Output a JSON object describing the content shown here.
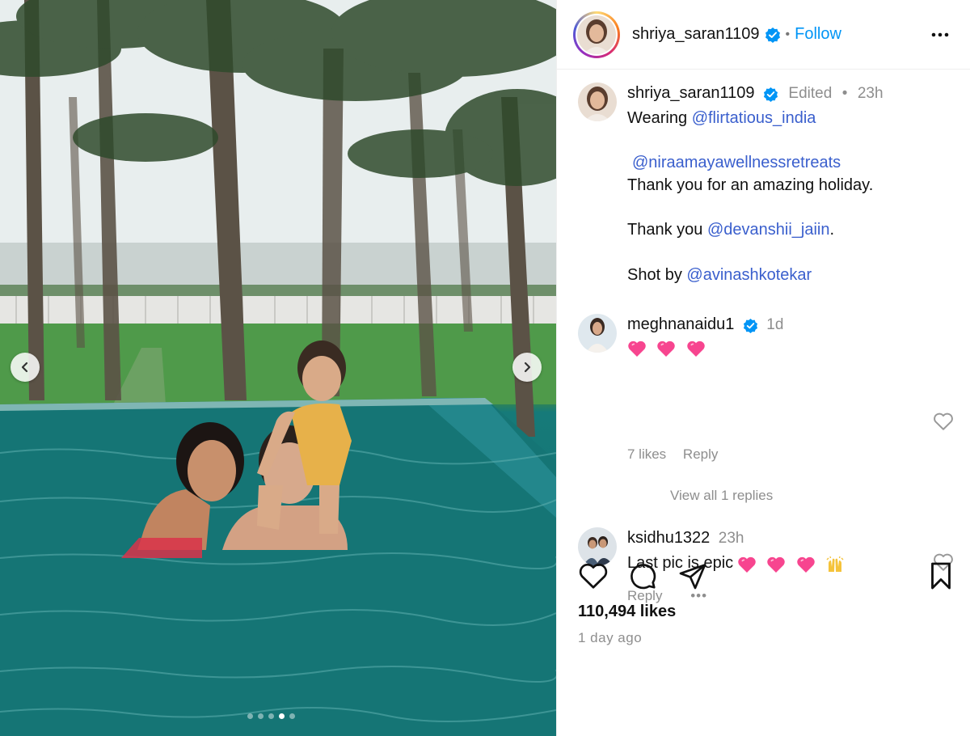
{
  "post": {
    "username": "shriya_saran1109",
    "follow_label": "Follow",
    "edited_label": "Edited",
    "time": "23h",
    "caption": {
      "line1_prefix": "Wearing",
      "mention1": "@flirtatious_india",
      "mention2": "@niraamayawellnessretreats",
      "line3": "Thank you for an amazing holiday.",
      "line4_prefix": "Thank you",
      "mention3": "@devanshii_jaiin",
      "line4_suffix": ".",
      "line5_prefix": "Shot by",
      "mention4": "@avinashkotekar"
    },
    "likes": "110,494 likes",
    "posted_ago": "1 day ago",
    "carousel": {
      "total_slides": 5,
      "active_slide": 4
    }
  },
  "comments": [
    {
      "username": "meghnanaidu1",
      "verified": true,
      "time": "1d",
      "emoji": [
        "pink-heart",
        "pink-heart",
        "pink-heart"
      ],
      "likes": "7 likes",
      "reply_label": "Reply",
      "view_replies": "View all 1 replies"
    },
    {
      "username": "ksidhu1322",
      "verified": false,
      "time": "23h",
      "text": "Last pic is epic",
      "emoji": [
        "pink-heart",
        "pink-heart",
        "pink-heart",
        "raised-hands"
      ],
      "reply_label": "Reply",
      "more": "•••"
    }
  ],
  "colors": {
    "link": "#0095f6",
    "mention": "#3a5fcd",
    "verified": "#0095f6",
    "muted": "#8e8e8e",
    "pink_heart": "#f7458f"
  },
  "icons": [
    "arrow-left-icon",
    "arrow-right-icon",
    "verified-icon",
    "more-horizontal-icon",
    "heart-outline-icon",
    "comment-icon",
    "share-icon",
    "bookmark-icon"
  ]
}
